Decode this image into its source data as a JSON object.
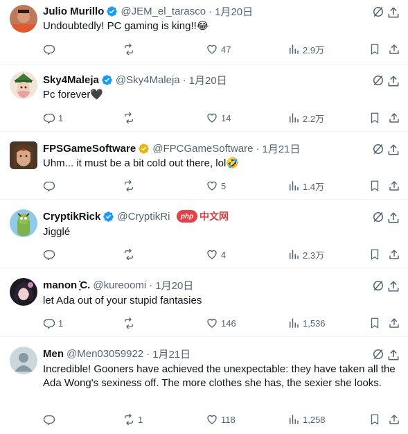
{
  "replies": [
    {
      "name": "Julio Murillo",
      "handle": "@JEM_el_tarasco",
      "time": "1月20日",
      "text": "Undoubtedly! PC gaming is king!!😂",
      "reply_count": "",
      "repost_count": "",
      "like_count": "47",
      "view_count": "2.9万",
      "verified": "blue"
    },
    {
      "name": "Sky4Maleja",
      "handle": "@Sky4Maleja",
      "time": "1月20日",
      "text": "Pc forever🖤",
      "reply_count": "1",
      "repost_count": "",
      "like_count": "14",
      "view_count": "2.2万",
      "verified": "blue"
    },
    {
      "name": "FPSGameSoftware",
      "handle": "@FPCGameSoftware",
      "time": "1月21日",
      "text": "Uhm... it must be a bit cold out there, lol🤣",
      "reply_count": "",
      "repost_count": "",
      "like_count": "5",
      "view_count": "1.4万",
      "verified": "gold"
    },
    {
      "name": "CryptikRick",
      "handle": "@CryptikRi",
      "time": "",
      "text": "Jigglé",
      "reply_count": "",
      "repost_count": "",
      "like_count": "4",
      "view_count": "2.3万",
      "verified": "blue"
    },
    {
      "name": "manon ̣̇̇C.",
      "handle": "@kureoomi",
      "time": "1月20日",
      "text": "let Ada out of your stupid fantasies",
      "reply_count": "1",
      "repost_count": "",
      "like_count": "146",
      "view_count": "1,536",
      "verified": "none"
    },
    {
      "name": "Men",
      "handle": "@Men03059922",
      "time": "1月21日",
      "text": "Incredible! Gooners have achieved the unexpectable: they have taken all the Ada Wong's sexiness off. The more clothes she has, the sexier she looks.",
      "reply_count": "",
      "repost_count": "1",
      "like_count": "118",
      "view_count": "1,258",
      "verified": "none"
    }
  ],
  "watermark": {
    "badge": "php",
    "text": "中文网"
  },
  "colors": {
    "text": "#0f1419",
    "secondary": "#536471",
    "verified_blue": "#1d9bf0",
    "verified_gold": "#e2b719",
    "divider": "#eff3f4"
  },
  "icons": [
    "reply-icon",
    "repost-icon",
    "like-icon",
    "views-icon",
    "bookmark-icon",
    "share-icon",
    "grok-icon",
    "more-icon",
    "verified-badge-icon"
  ]
}
